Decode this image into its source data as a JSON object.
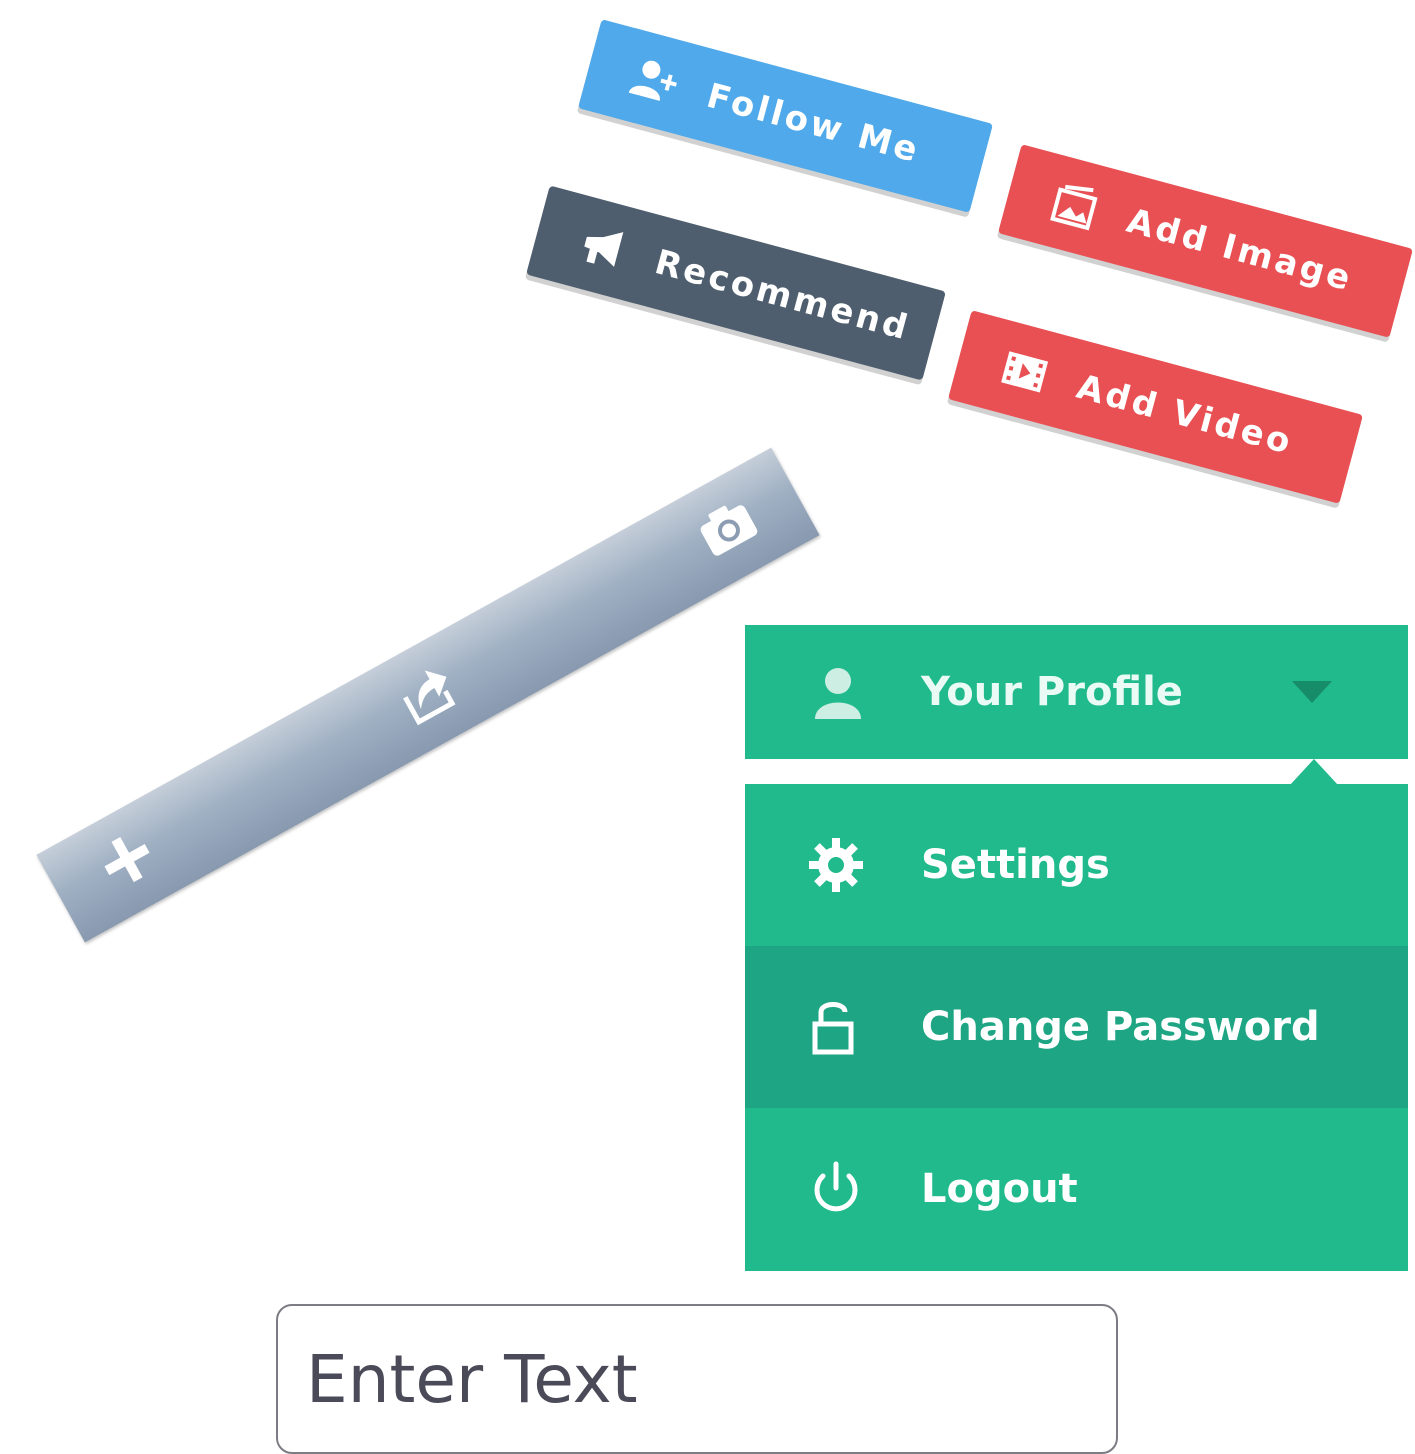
{
  "buttons": {
    "follow": {
      "label": "Follow Me",
      "icon": "add-user-icon",
      "color": "#4fa9ea"
    },
    "recommend": {
      "label": "Recommend",
      "icon": "megaphone-icon",
      "color": "#4e5e6e"
    },
    "add_image": {
      "label": "Add Image",
      "icon": "image-icon",
      "color": "#e85053"
    },
    "add_video": {
      "label": "Add Video",
      "icon": "video-icon",
      "color": "#e85053"
    }
  },
  "toolbar": {
    "items": [
      {
        "icon": "plus-icon"
      },
      {
        "icon": "share-icon"
      },
      {
        "icon": "camera-icon"
      }
    ]
  },
  "profile_menu": {
    "header": {
      "label": "Your Profile",
      "icon": "user-icon"
    },
    "accent_color": "#20ba8c",
    "items": [
      {
        "label": "Settings",
        "icon": "gear-icon"
      },
      {
        "label": "Change Password",
        "icon": "unlock-icon",
        "highlighted": true
      },
      {
        "label": "Logout",
        "icon": "power-icon"
      }
    ]
  },
  "input": {
    "placeholder": "Enter Text",
    "value": ""
  }
}
